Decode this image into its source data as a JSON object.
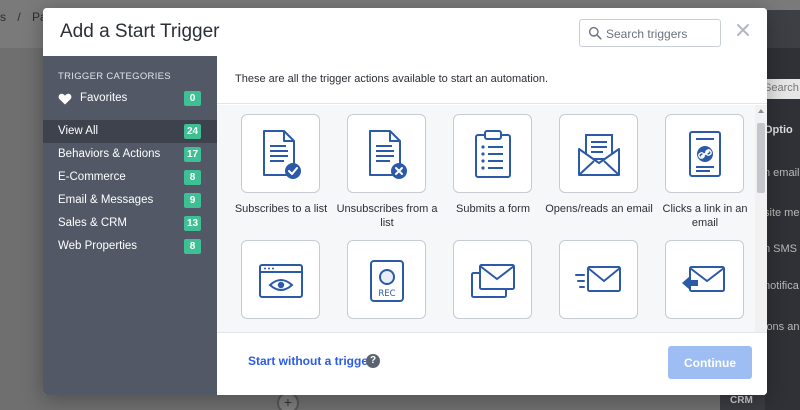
{
  "background": {
    "breadcrumb": [
      "s",
      "/",
      "Part"
    ],
    "right_panel": {
      "search_placeholder": "Search acti",
      "items": [
        "Optio",
        "n email",
        "site me",
        "n SMS",
        "notifica",
        "ions and",
        "CRM"
      ]
    }
  },
  "modal": {
    "title": "Add a Start Trigger",
    "search_placeholder": "Search triggers",
    "sidebar": {
      "heading": "TRIGGER CATEGORIES",
      "categories": [
        {
          "label": "Favorites",
          "count": "0"
        },
        {
          "label": "View All",
          "count": "24"
        },
        {
          "label": "Behaviors & Actions",
          "count": "17"
        },
        {
          "label": "E-Commerce",
          "count": "8"
        },
        {
          "label": "Email & Messages",
          "count": "9"
        },
        {
          "label": "Sales & CRM",
          "count": "13"
        },
        {
          "label": "Web Properties",
          "count": "8"
        }
      ]
    },
    "intro": "These are all the trigger actions available to start an automation.",
    "triggers": [
      {
        "label": "Subscribes to a list",
        "icon": "document-check-icon"
      },
      {
        "label": "Unsubscribes from a list",
        "icon": "document-x-icon"
      },
      {
        "label": "Submits a form",
        "icon": "clipboard-form-icon"
      },
      {
        "label": "Opens/reads an email",
        "icon": "open-envelope-icon"
      },
      {
        "label": "Clicks a link in an email",
        "icon": "email-link-icon"
      },
      {
        "label": "",
        "icon": "browser-eye-icon"
      },
      {
        "label": "",
        "icon": "rec-device-icon"
      },
      {
        "label": "",
        "icon": "multiple-envelopes-icon"
      },
      {
        "label": "",
        "icon": "send-envelope-icon"
      },
      {
        "label": "",
        "icon": "reply-envelope-icon"
      }
    ],
    "footer": {
      "start_without": "Start without a trigger",
      "help": "?",
      "continue": "Continue"
    }
  },
  "colors": {
    "accent": "#2b5ce6",
    "badge": "#3fbf94",
    "sidebar": "#525866",
    "continue_disabled": "#9dbdf3"
  }
}
